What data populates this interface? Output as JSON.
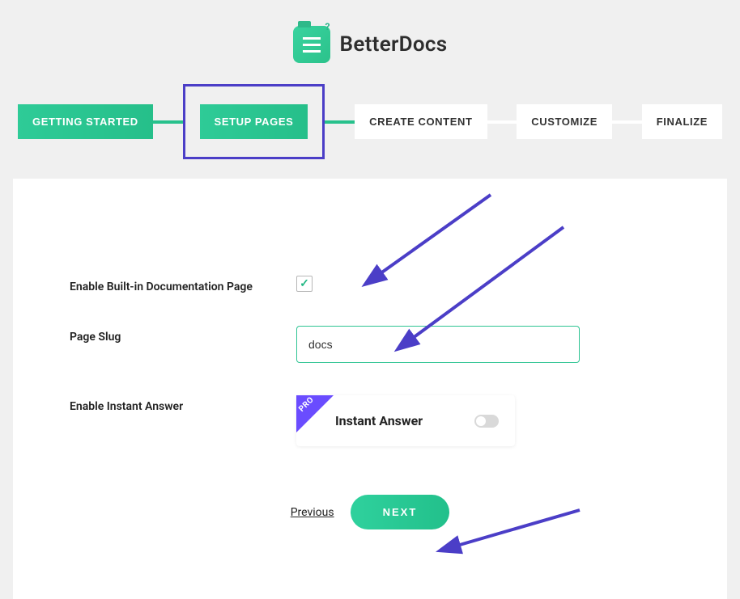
{
  "brand": {
    "name": "BetterDocs"
  },
  "steps": [
    {
      "label": "GETTING STARTED",
      "state": "done"
    },
    {
      "label": "SETUP PAGES",
      "state": "current"
    },
    {
      "label": "CREATE CONTENT",
      "state": "todo"
    },
    {
      "label": "CUSTOMIZE",
      "state": "todo"
    },
    {
      "label": "FINALIZE",
      "state": "todo"
    }
  ],
  "form": {
    "enable_doc_page": {
      "label": "Enable Built-in Documentation Page",
      "checked": true
    },
    "page_slug": {
      "label": "Page Slug",
      "value": "docs"
    },
    "instant_answer": {
      "label": "Enable Instant Answer",
      "panel_title": "Instant Answer",
      "pro_badge": "PRO",
      "enabled": false
    }
  },
  "nav": {
    "prev": "Previous",
    "next": "NEXT"
  },
  "colors": {
    "accent": "#27c18c",
    "annotation": "#4b3ec7"
  }
}
